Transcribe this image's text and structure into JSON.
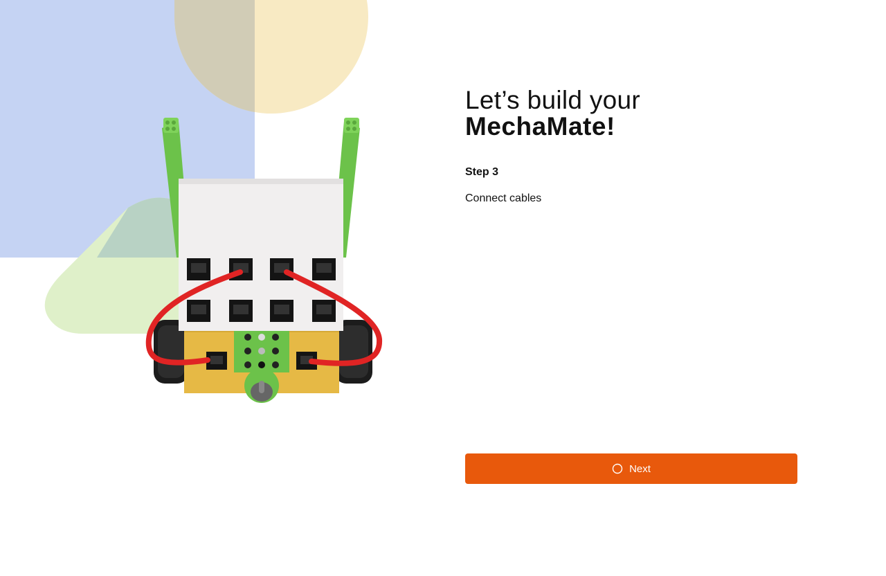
{
  "heading": {
    "line1": "Let’s build your",
    "line2": "MechaMate!"
  },
  "step": {
    "label": "Step 3",
    "description": "Connect cables"
  },
  "next_button": {
    "label": "Next",
    "icon": "spinner-icon"
  },
  "colors": {
    "accent": "#e8590c",
    "bg_blue": "#c5d3f3",
    "bg_yellow": "#f8eac3",
    "bg_green": "#dff0c9",
    "cable_red": "#e02424",
    "robot_green": "#6cc24a",
    "robot_yellow": "#e6b945"
  }
}
